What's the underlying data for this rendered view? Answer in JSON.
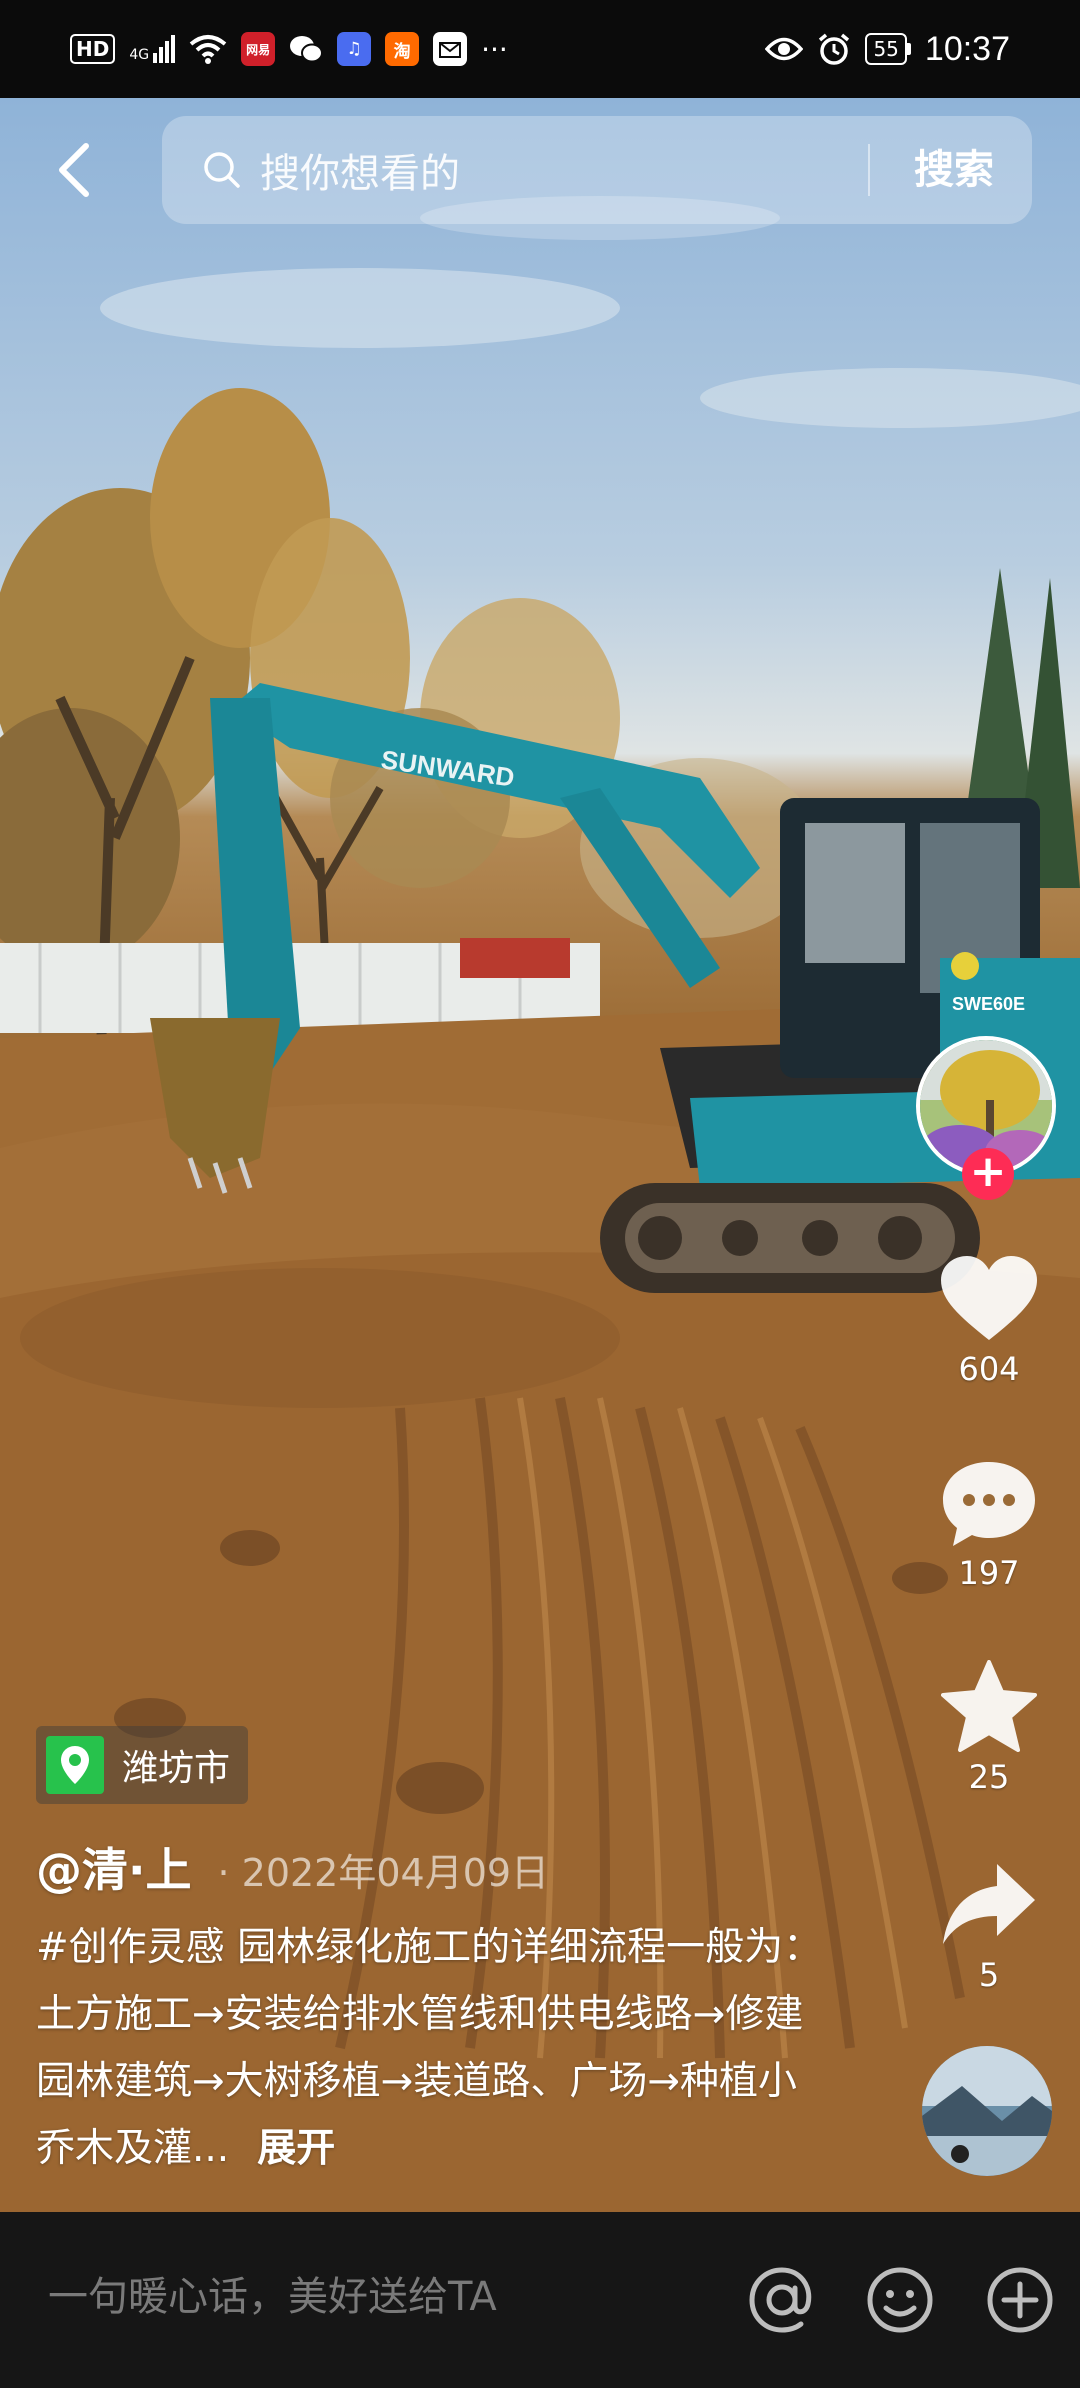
{
  "status_bar": {
    "hd": "HD",
    "network": "4G",
    "apps": [
      {
        "name": "netease-icon",
        "label": "网易",
        "color": "#d0202a"
      },
      {
        "name": "wechat-icon",
        "label": "",
        "color": "#000000"
      },
      {
        "name": "music-icon",
        "label": "♫",
        "color": "#4a6cf0"
      },
      {
        "name": "taobao-icon",
        "label": "淘",
        "color": "#ff6a00"
      },
      {
        "name": "app-icon",
        "label": "",
        "color": "#ffffff"
      }
    ],
    "more": "···",
    "battery": "55",
    "time": "10:37"
  },
  "search": {
    "placeholder": "搜你想看的",
    "button": "搜索"
  },
  "location": {
    "name": "潍坊市"
  },
  "post": {
    "author": "@清·上",
    "date": "· 2022年04月09日",
    "caption": "#创作灵感 园林绿化施工的详细流程一般为：土方施工→安装给排水管线和供电线路→修建园林建筑→大树移植→装道路、广场→种植小乔木及灌...",
    "expand": "展开"
  },
  "actions": {
    "likes": "604",
    "comments": "197",
    "favorites": "25",
    "shares": "5"
  },
  "video": {
    "machine_brand": "SUNWARD",
    "model": "SWE60E"
  },
  "comment_bar": {
    "placeholder": "一句暖心话，美好送给TA"
  },
  "colors": {
    "follow": "#fe2c55",
    "location_pin": "#27c24c",
    "excavator": "#1f93a3"
  }
}
